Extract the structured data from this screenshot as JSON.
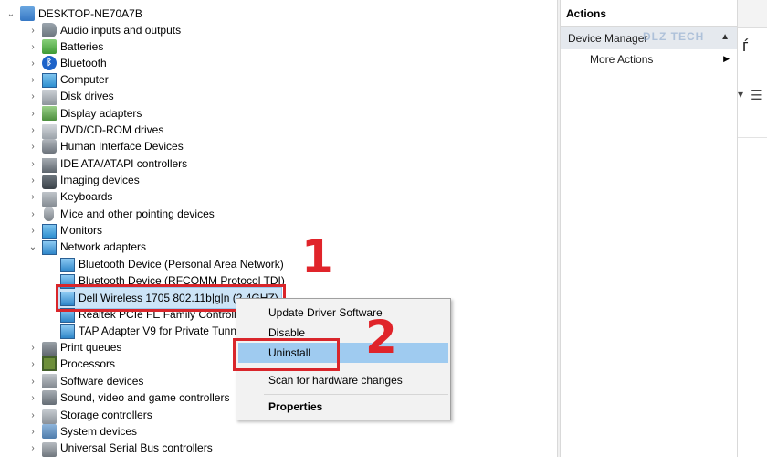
{
  "tree": {
    "root": "DESKTOP-NE70A7B",
    "categories": [
      {
        "label": "Audio inputs and outputs",
        "icon": "speaker-icon"
      },
      {
        "label": "Batteries",
        "icon": "battery-icon"
      },
      {
        "label": "Bluetooth",
        "icon": "bluetooth-icon"
      },
      {
        "label": "Computer",
        "icon": "monitor-icon"
      },
      {
        "label": "Disk drives",
        "icon": "disk-drive-icon"
      },
      {
        "label": "Display adapters",
        "icon": "display-adapter-icon"
      },
      {
        "label": "DVD/CD-ROM drives",
        "icon": "dvd-drive-icon"
      },
      {
        "label": "Human Interface Devices",
        "icon": "hid-icon"
      },
      {
        "label": "IDE ATA/ATAPI controllers",
        "icon": "ide-controller-icon"
      },
      {
        "label": "Imaging devices",
        "icon": "camera-icon"
      },
      {
        "label": "Keyboards",
        "icon": "keyboard-icon"
      },
      {
        "label": "Mice and other pointing devices",
        "icon": "mouse-icon"
      },
      {
        "label": "Monitors",
        "icon": "monitor-icon"
      }
    ],
    "network_adapters": {
      "label": "Network adapters",
      "children": [
        "Bluetooth Device (Personal Area Network)",
        "Bluetooth Device (RFCOMM Protocol TDI)",
        "Dell Wireless 1705 802.11b|g|n (2.4GHZ)",
        "Realtek PCIe FE Family Controlle",
        "TAP Adapter V9 for Private Tunn"
      ]
    },
    "categories_after": [
      {
        "label": "Print queues",
        "icon": "printer-icon"
      },
      {
        "label": "Processors",
        "icon": "processor-icon"
      },
      {
        "label": "Software devices",
        "icon": "software-device-icon"
      },
      {
        "label": "Sound, video and game controllers",
        "icon": "sound-icon"
      },
      {
        "label": "Storage controllers",
        "icon": "storage-icon"
      },
      {
        "label": "System devices",
        "icon": "system-device-icon"
      },
      {
        "label": "Universal Serial Bus controllers",
        "icon": "usb-icon"
      }
    ]
  },
  "annotations": {
    "step1": "1",
    "step2": "2"
  },
  "actions": {
    "title": "Actions",
    "section": "Device Manager",
    "more": "More Actions",
    "watermark": "DLZ TECH"
  },
  "context_menu": {
    "items": [
      "Update Driver Software",
      "Disable",
      "Uninstall",
      "Scan for hardware changes",
      "Properties"
    ],
    "highlighted": "Uninstall"
  },
  "colors": {
    "accent": "#cce4f7",
    "highlight": "#9fcbf0",
    "annotation_red": "#e0242a"
  }
}
